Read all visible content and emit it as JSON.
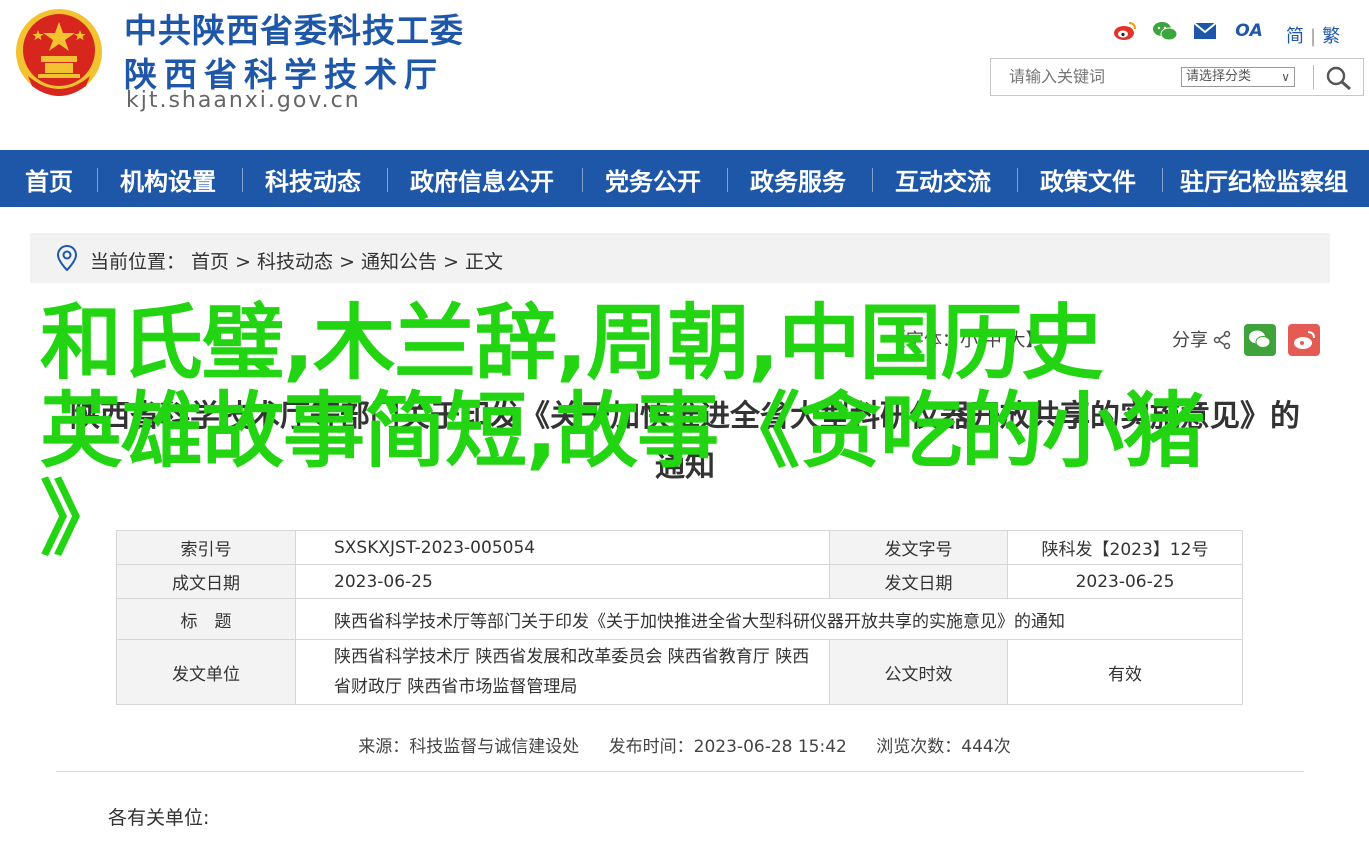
{
  "header": {
    "org_line1": "中共陕西省委科技工委",
    "org_line2": "陕西省科学技术厅",
    "domain": "kjt.shaanxi.gov.cn",
    "lang_simplified": "简",
    "lang_separator": "|",
    "lang_traditional": "繁",
    "icons": [
      "weibo-icon",
      "wechat-icon",
      "mail-icon",
      "oa-icon"
    ],
    "oa_label": "OA"
  },
  "search": {
    "placeholder": "请输入关键词",
    "category_label": "请选择分类",
    "category_arrow": "∨"
  },
  "nav": {
    "items": [
      {
        "label": "首页"
      },
      {
        "label": "机构设置"
      },
      {
        "label": "科技动态"
      },
      {
        "label": "政府信息公开"
      },
      {
        "label": "党务公开"
      },
      {
        "label": "政务服务"
      },
      {
        "label": "互动交流"
      },
      {
        "label": "政策文件"
      },
      {
        "label": "驻厅纪检监察组"
      }
    ]
  },
  "breadcrumb": {
    "text": "当前位置： 首页 > 科技动态 > 通知公告 > 正文"
  },
  "article": {
    "title": "陕西省科学技术厅等部门关于印发《关于加快推进全省大型科研仪器开放共享的实施意见》的通知",
    "font_size_label": "【字体：小 中 大】",
    "share_label": "分享",
    "overlay_text": "和氏璧,木兰辞,周朝,中国历史\n英雄故事简短,故事《贪吃的小猪\n》",
    "info": {
      "index_label": "索引号",
      "index_value": "SXSKXJST-2023-005054",
      "doc_no_label": "发文字号",
      "doc_no_value": "陕科发【2023】12号",
      "written_label": "成文日期",
      "written_value": "2023-06-25",
      "issued_label": "发文日期",
      "issued_value": "2023-06-25",
      "title_label": "标　题",
      "title_value": "陕西省科学技术厅等部门关于印发《关于加快推进全省大型科研仪器开放共享的实施意见》的通知",
      "unit_label": "发文单位",
      "unit_value": "陕西省科学技术厅 陕西省发展和改革委员会 陕西省教育厅 陕西省财政厅 陕西省市场监督管理局",
      "validity_label": "公文时效",
      "validity_value": "有效"
    },
    "meta": {
      "source": "来源：科技监督与诚信建设处",
      "published": "发布时间：2023-06-28 15:42",
      "views": "浏览次数：444次"
    },
    "greeting": "各有关单位:"
  },
  "colors": {
    "brand_blue": "#1f57a8",
    "overlay_green": "#22d411",
    "emblem_red": "#d7261e",
    "emblem_gold": "#f2c230"
  }
}
